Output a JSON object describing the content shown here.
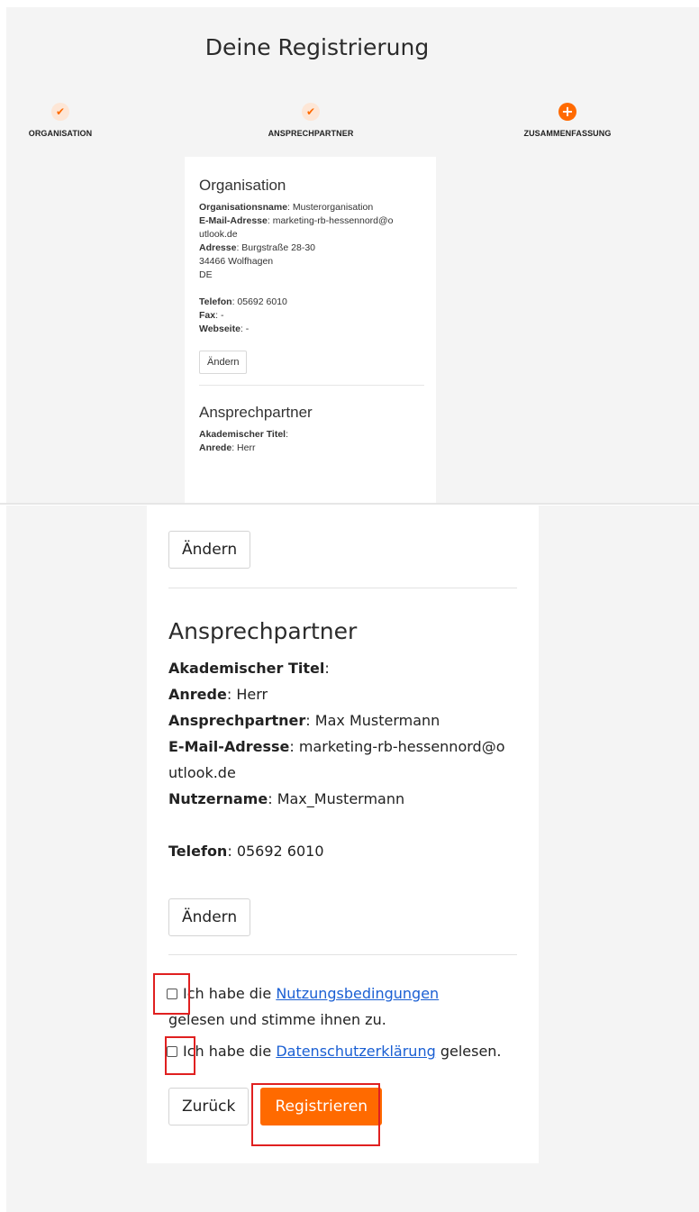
{
  "header": {
    "title": "Deine Registrierung"
  },
  "stepper": {
    "steps": [
      {
        "label": "ORGANISATION",
        "icon": "check-icon",
        "symbol": "✔"
      },
      {
        "label": "ANSPRECHPARTNER",
        "icon": "check-icon",
        "symbol": "✔"
      },
      {
        "label": "ZUSAMMENFASSUNG",
        "icon": "plus-icon",
        "symbol": "+"
      }
    ],
    "accent_color": "#ff6a00"
  },
  "organisation": {
    "title": "Organisation",
    "name_label": "Organisationsname",
    "name_value": "Musterorganisation",
    "email_label": "E-Mail-Adresse",
    "email_value_1": "marketing-rb-hessennord@o",
    "email_value_2": "utlook.de",
    "address_label": "Adresse",
    "address_street": "Burgstraße 28-30",
    "address_city": "34466 Wolfhagen",
    "address_country": "DE",
    "phone_label": "Telefon",
    "phone_value": "05692 6010",
    "fax_label": "Fax",
    "fax_value": "-",
    "website_label": "Webseite",
    "website_value": "-",
    "edit_label": "Ändern"
  },
  "contact": {
    "title": "Ansprechpartner",
    "academic_title_label": "Akademischer Titel",
    "academic_title_value": "",
    "salutation_label": "Anrede",
    "salutation_value": "Herr",
    "contact_label": "Ansprechpartner",
    "contact_value": "Max Mustermann",
    "email_label": "E-Mail-Adresse",
    "email_value_1": "marketing-rb-hessennord@o",
    "email_value_2": "utlook.de",
    "username_label": "Nutzername",
    "username_value": "Max_Mustermann",
    "phone_label": "Telefon",
    "phone_value": "05692 6010",
    "edit_label": "Ändern"
  },
  "consent": {
    "terms_prefix": "Ich habe die ",
    "terms_link": "Nutzungsbedingungen",
    "terms_suffix": "gelesen und stimme ihnen zu.",
    "privacy_prefix": "Ich habe die ",
    "privacy_link": "Datenschutzerklärung",
    "privacy_suffix": " gelesen.",
    "terms_checked": false,
    "privacy_checked": false
  },
  "actions": {
    "back_label": "Zurück",
    "register_label": "Registrieren"
  },
  "colors": {
    "primary": "#ff6a00",
    "link": "#1a5fd3",
    "highlight": "#e02020",
    "background": "#f4f4f4"
  }
}
